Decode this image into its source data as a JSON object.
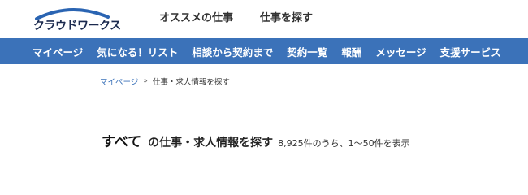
{
  "header": {
    "logo_text": "クラウドワークス",
    "links": [
      "オススメの仕事",
      "仕事を探す"
    ]
  },
  "nav": {
    "items": [
      "マイページ",
      "気になる！リスト",
      "相談から契約まで",
      "契約一覧",
      "報酬",
      "メッセージ",
      "支援サービス"
    ]
  },
  "breadcrumb": {
    "home": "マイページ",
    "separator": "»",
    "current": "仕事・求人情報を探す"
  },
  "heading": {
    "category": "すべて",
    "title": "の仕事・求人情報を探す",
    "count": "8,925件のうち、1〜50件を表示"
  },
  "colors": {
    "nav_bg": "#3b72b9",
    "logo_arc": "#2a64b2",
    "logo_text": "#1b2a4e"
  }
}
